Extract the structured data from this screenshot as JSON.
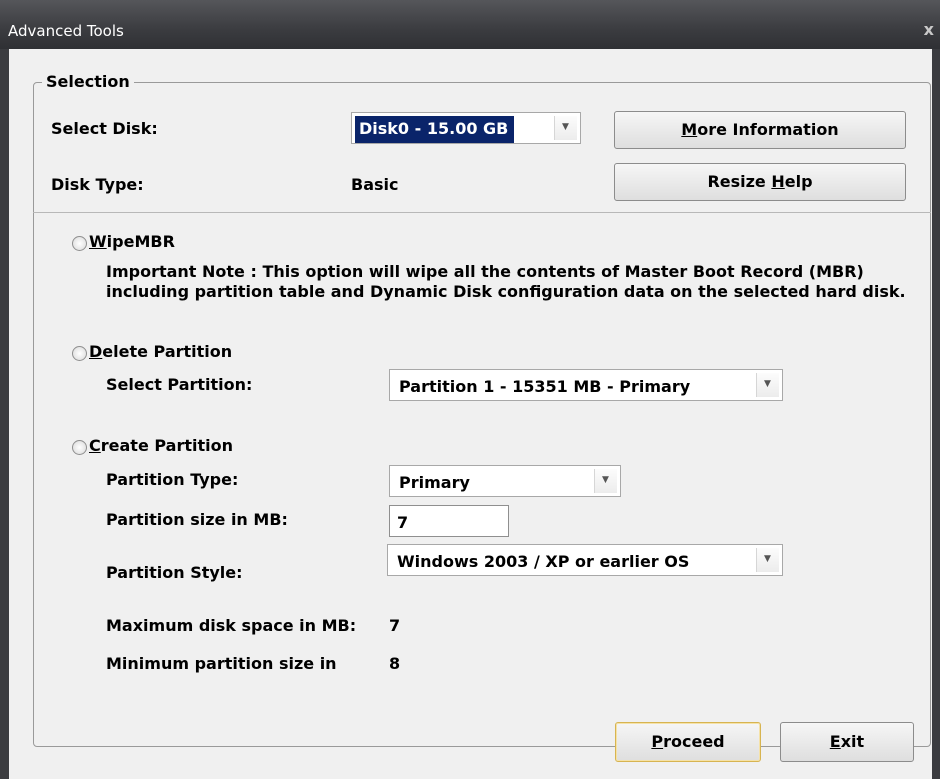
{
  "window": {
    "title": "Advanced Tools",
    "close_glyph": "x"
  },
  "selection": {
    "legend": "Selection",
    "select_disk_label": "Select Disk:",
    "select_disk_value": "Disk0 - 15.00 GB",
    "disk_type_label": "Disk Type:",
    "disk_type_value": "Basic",
    "more_info_button": {
      "mnemonic": "M",
      "rest": "ore Information"
    },
    "resize_help_button": {
      "prefix": "Resize ",
      "mnemonic": "H",
      "rest": "elp"
    }
  },
  "wipe_mbr": {
    "mnemonic": "W",
    "rest": "ipeMBR",
    "note": "Important Note : This option will wipe all the contents of Master Boot Record (MBR) including partition table and Dynamic Disk configuration data on the selected hard disk."
  },
  "delete_partition": {
    "mnemonic": "D",
    "rest": "elete Partition",
    "select_partition_label": "Select Partition:",
    "select_partition_value": "Partition 1 - 15351 MB - Primary"
  },
  "create_partition": {
    "mnemonic": "C",
    "rest": "reate Partition",
    "partition_type_label": "Partition Type:",
    "partition_type_value": "Primary",
    "partition_size_label": "Partition size in MB:",
    "partition_size_value": "7",
    "partition_style_label": "Partition Style:",
    "partition_style_value": "Windows 2003 / XP or earlier OS",
    "max_space_label": "Maximum disk space in MB:",
    "max_space_value": "7",
    "min_size_label": "Minimum partition size in",
    "min_size_value": "8"
  },
  "buttons": {
    "proceed": {
      "mnemonic": "P",
      "rest": "roceed"
    },
    "exit": {
      "mnemonic": "E",
      "rest": "xit"
    }
  },
  "icons": {
    "dropdown": "chevron-down-icon"
  }
}
